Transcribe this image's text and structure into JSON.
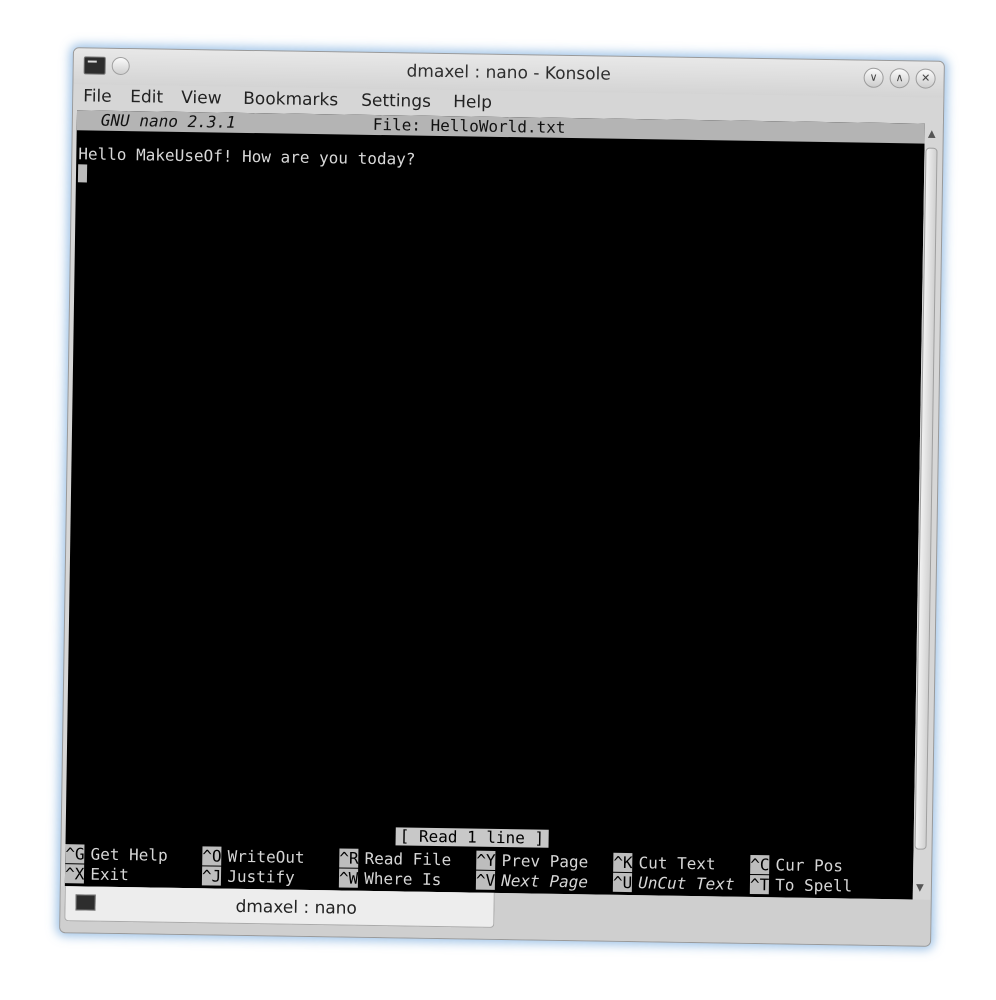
{
  "window": {
    "title": "dmaxel : nano - Konsole",
    "buttons": {
      "minimize": "∨",
      "maximize": "∧",
      "close": "✕"
    }
  },
  "menu": [
    "File",
    "Edit",
    "View",
    "Bookmarks",
    "Settings",
    "Help"
  ],
  "nano": {
    "version": "GNU nano 2.3.1",
    "file": "File: HelloWorld.txt",
    "content": "Hello MakeUseOf! How are you today?",
    "status": "[ Read 1 line ]",
    "shortcuts_row1": [
      {
        "key": "^G",
        "label": "Get Help",
        "italic": false
      },
      {
        "key": "^O",
        "label": "WriteOut",
        "italic": false
      },
      {
        "key": "^R",
        "label": "Read File",
        "italic": false
      },
      {
        "key": "^Y",
        "label": "Prev Page",
        "italic": false
      },
      {
        "key": "^K",
        "label": "Cut Text",
        "italic": false
      },
      {
        "key": "^C",
        "label": "Cur Pos",
        "italic": false
      }
    ],
    "shortcuts_row2": [
      {
        "key": "^X",
        "label": "Exit",
        "italic": false
      },
      {
        "key": "^J",
        "label": "Justify",
        "italic": false
      },
      {
        "key": "^W",
        "label": "Where Is",
        "italic": false
      },
      {
        "key": "^V",
        "label": "Next Page",
        "italic": true
      },
      {
        "key": "^U",
        "label": "UnCut Text",
        "italic": true
      },
      {
        "key": "^T",
        "label": "To Spell",
        "italic": false
      }
    ]
  },
  "tab": {
    "label": "dmaxel : nano"
  },
  "colors": {
    "terminal_bg": "#000000",
    "glow": "#78aadc",
    "header_bg": "#b4b4b4"
  }
}
